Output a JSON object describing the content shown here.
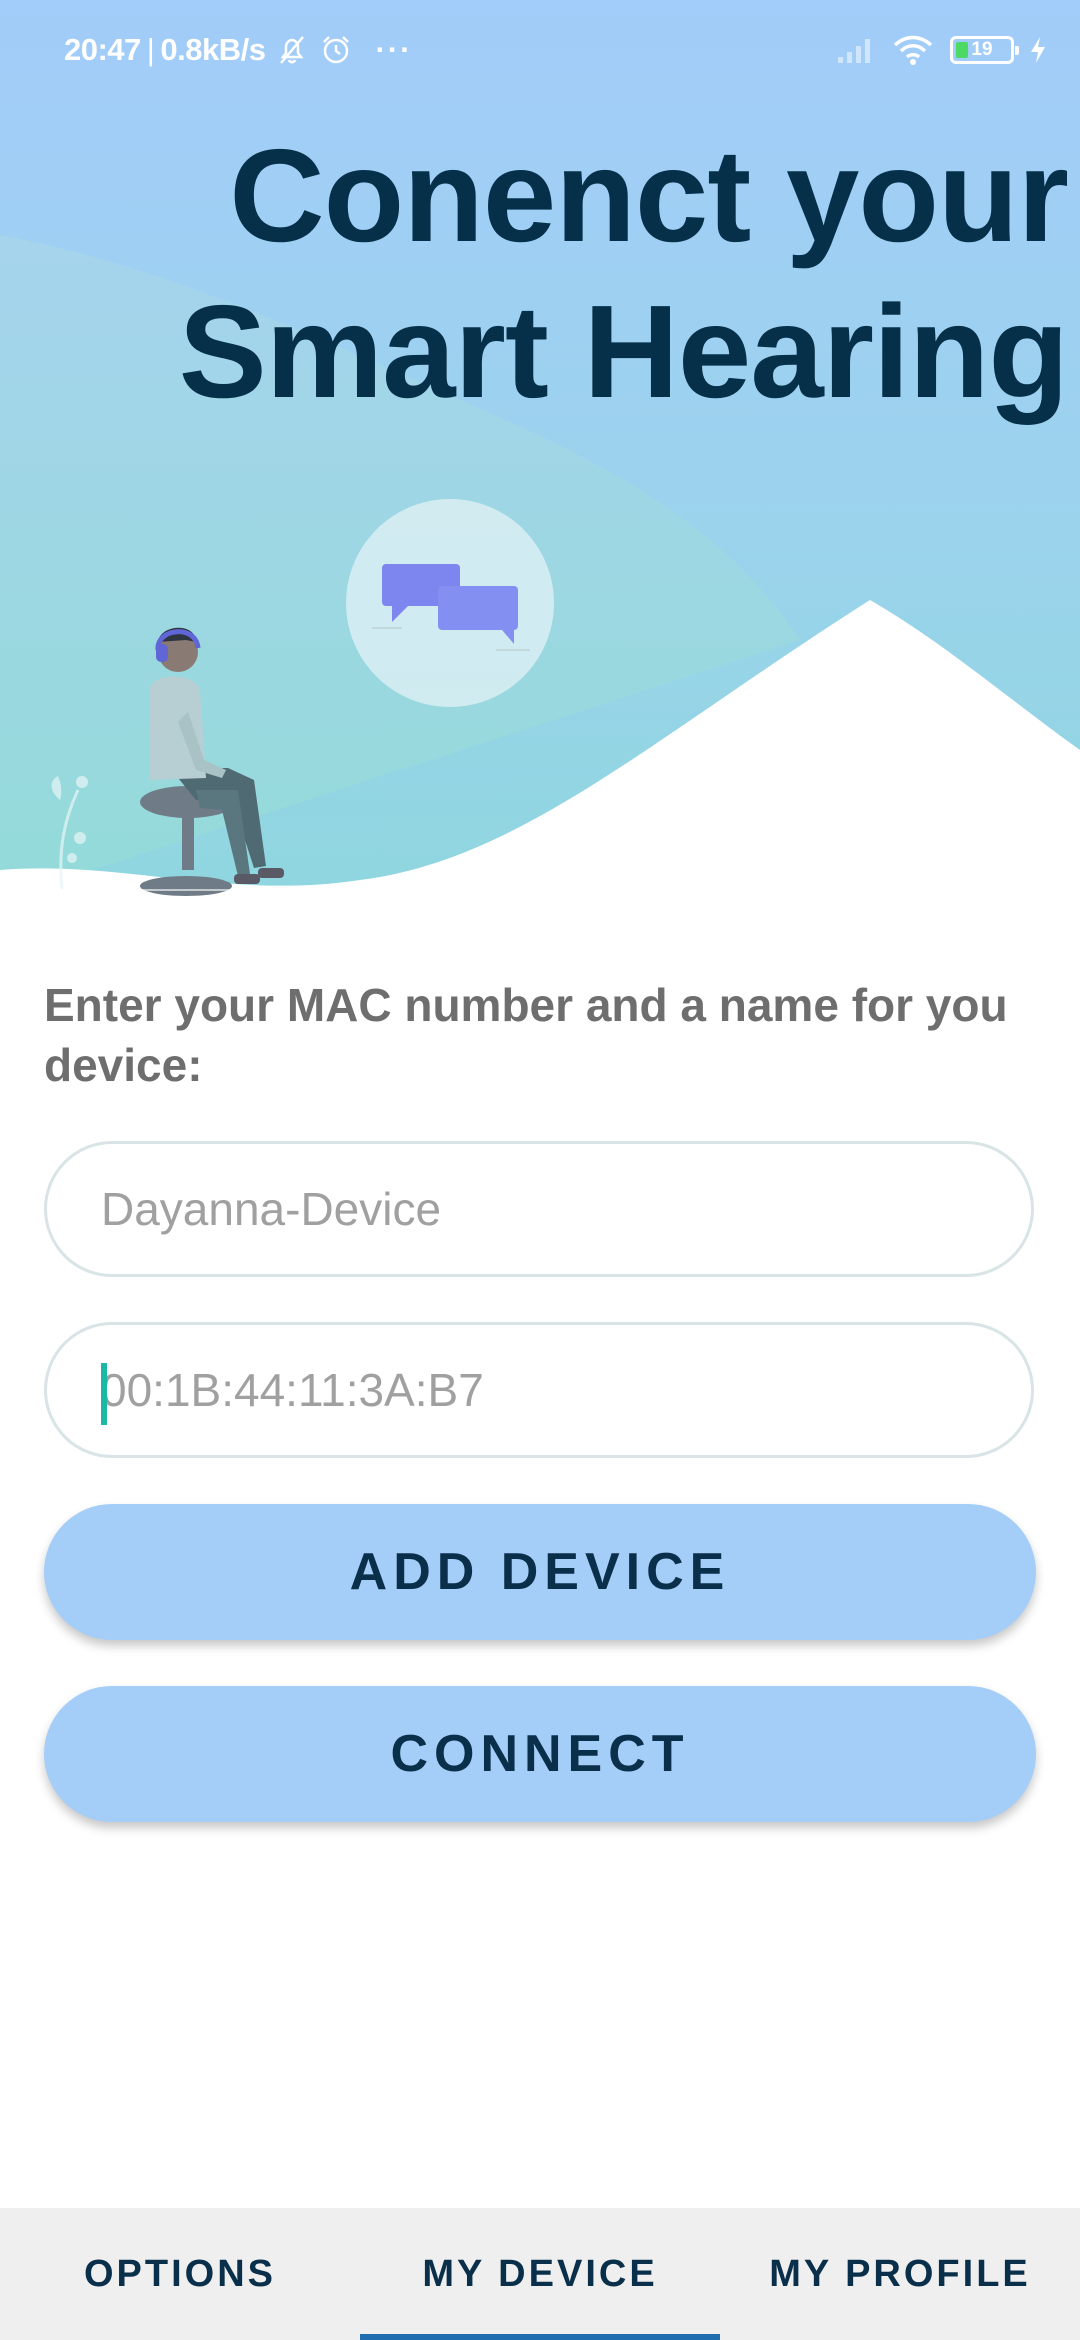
{
  "status_bar": {
    "time": "20:47",
    "network_speed": "0.8kB/s",
    "separator": "|",
    "more": "···",
    "battery_level": "19",
    "icons": [
      "bell-off-icon",
      "alarm-icon",
      "signal-icon",
      "wifi-icon",
      "battery-icon",
      "charging-icon"
    ]
  },
  "header": {
    "title_line1": "Conenct your",
    "title_line2": "Smart Hearing"
  },
  "form": {
    "prompt": "Enter your MAC number and a name for you device:",
    "name_field": {
      "value": "",
      "placeholder": "Dayanna-Device"
    },
    "mac_field": {
      "value": "",
      "placeholder": "00:1B:44:11:3A:B7"
    },
    "add_button_label": "ADD DEVICE",
    "connect_button_label": "CONNECT"
  },
  "bottom_nav": {
    "tabs": [
      {
        "label": "OPTIONS"
      },
      {
        "label": "MY DEVICE"
      },
      {
        "label": "MY PROFILE"
      }
    ],
    "selected_tab": "MY DEVICE"
  },
  "colors": {
    "accent": "#a4cdf8",
    "title": "#06304a",
    "tab_indicator": "#1f6fb0",
    "caret": "#1bb8a7"
  }
}
